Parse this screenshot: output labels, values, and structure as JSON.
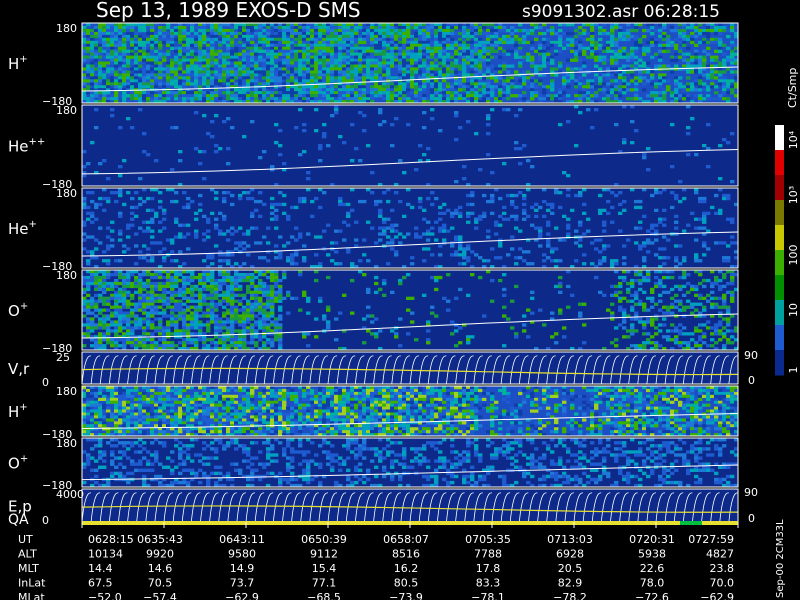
{
  "header": {
    "date": "Sep 13, 1989",
    "instrument": "EXOS-D SMS",
    "file": "s9091302.asr",
    "time": "06:28:15"
  },
  "panels": [
    {
      "label": "H",
      "sup": "+",
      "top": "180",
      "bottom": "−180"
    },
    {
      "label": "He",
      "sup": "++",
      "top": "180",
      "bottom": "−180"
    },
    {
      "label": "He",
      "sup": "+",
      "top": "180",
      "bottom": "−180"
    },
    {
      "label": "O",
      "sup": "+",
      "top": "180",
      "bottom": "−180"
    },
    {
      "label": "V,r",
      "sup": "",
      "top": "25",
      "bottom": "0",
      "right": "90",
      "right2": "0"
    },
    {
      "label": "H",
      "sup": "+",
      "top": "180",
      "bottom": "−180"
    },
    {
      "label": "O",
      "sup": "+",
      "top": "180",
      "bottom": "−180"
    },
    {
      "label": "E,p",
      "sup": "",
      "top": "4000",
      "bottom": "0",
      "right": "90",
      "right2": "0"
    }
  ],
  "qa_label": "QA",
  "colorbar": {
    "unit": "Ct/Smp",
    "ticks": [
      "10⁴",
      "10³",
      "100",
      "10",
      "1"
    ],
    "colors": [
      "#ffffff",
      "#e00000",
      "#a00000",
      "#7a7a00",
      "#c8c800",
      "#3cb000",
      "#009000",
      "#00a0a0",
      "#1e5ad0",
      "#0a2a90"
    ]
  },
  "footer": {
    "row_labels": [
      "UT",
      "ALT",
      "MLT",
      "InLat",
      "MLat"
    ],
    "columns": [
      {
        "UT": "0628:15",
        "ALT": "10134",
        "MLT": "14.4",
        "InLat": "67.5",
        "MLat": "−52.0"
      },
      {
        "UT": "0635:43",
        "ALT": "9920",
        "MLT": "14.6",
        "InLat": "70.5",
        "MLat": "−57.4"
      },
      {
        "UT": "0643:11",
        "ALT": "9580",
        "MLT": "14.9",
        "InLat": "73.7",
        "MLat": "−62.9"
      },
      {
        "UT": "0650:39",
        "ALT": "9112",
        "MLT": "15.4",
        "InLat": "77.1",
        "MLat": "−68.5"
      },
      {
        "UT": "0658:07",
        "ALT": "8516",
        "MLT": "16.2",
        "InLat": "80.5",
        "MLat": "−73.9"
      },
      {
        "UT": "0705:35",
        "ALT": "7788",
        "MLT": "17.8",
        "InLat": "83.3",
        "MLat": "−78.1"
      },
      {
        "UT": "0713:03",
        "ALT": "6928",
        "MLT": "20.5",
        "InLat": "82.9",
        "MLat": "−78.2"
      },
      {
        "UT": "0720:31",
        "ALT": "5938",
        "MLT": "22.6",
        "InLat": "78.0",
        "MLat": "−72.6"
      },
      {
        "UT": "0727:59",
        "ALT": "4827",
        "MLT": "23.8",
        "InLat": "70.0",
        "MLat": "−62.9"
      }
    ],
    "side_note": "Sep-00  2CM33L"
  },
  "chart_data": {
    "type": "heatmap",
    "title": "Sep 13, 1989   EXOS-D SMS",
    "xlabel": "UT",
    "x": [
      "0628:15",
      "0635:43",
      "0643:11",
      "0650:39",
      "0658:07",
      "0705:35",
      "0713:03",
      "0720:31",
      "0727:59"
    ],
    "series": [
      {
        "name": "H+",
        "ylim": [
          -180,
          180
        ]
      },
      {
        "name": "He++",
        "ylim": [
          -180,
          180
        ]
      },
      {
        "name": "He+",
        "ylim": [
          -180,
          180
        ]
      },
      {
        "name": "O+",
        "ylim": [
          -180,
          180
        ]
      },
      {
        "name": "V,r",
        "ylim": [
          0,
          25
        ],
        "ylim_right": [
          0,
          90
        ]
      },
      {
        "name": "H+",
        "ylim": [
          -180,
          180
        ]
      },
      {
        "name": "O+",
        "ylim": [
          -180,
          180
        ]
      },
      {
        "name": "E,p",
        "ylim": [
          0,
          4000
        ],
        "ylim_right": [
          0,
          90
        ]
      }
    ],
    "colorbar_unit": "Ct/Smp",
    "colorbar_range": [
      1,
      10000
    ]
  }
}
